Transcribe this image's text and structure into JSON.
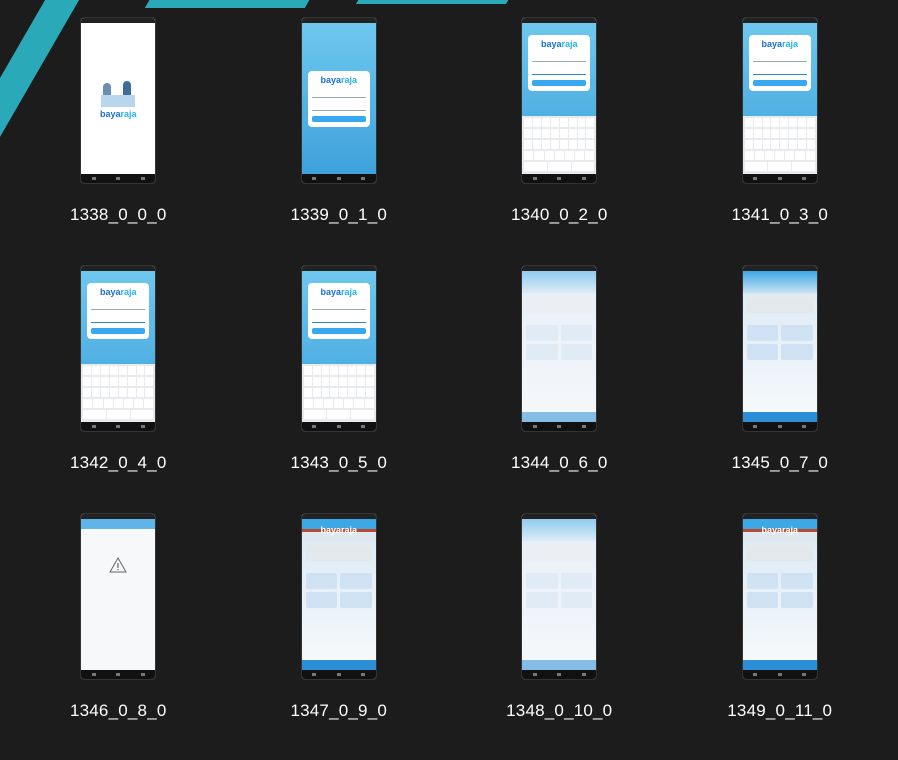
{
  "brand": {
    "logo_main": "baya",
    "logo_accent": "raja"
  },
  "tiles": [
    {
      "caption": "1338_0_0_0",
      "screen": "splash"
    },
    {
      "caption": "1339_0_1_0",
      "screen": "login"
    },
    {
      "caption": "1340_0_2_0",
      "screen": "login-keyboard"
    },
    {
      "caption": "1341_0_3_0",
      "screen": "login-keyboard"
    },
    {
      "caption": "1342_0_4_0",
      "screen": "login-keyboard"
    },
    {
      "caption": "1343_0_5_0",
      "screen": "login-keyboard"
    },
    {
      "caption": "1344_0_6_0",
      "screen": "home-faded"
    },
    {
      "caption": "1345_0_7_0",
      "screen": "home"
    },
    {
      "caption": "1346_0_8_0",
      "screen": "empty-state"
    },
    {
      "caption": "1347_0_9_0",
      "screen": "home-header"
    },
    {
      "caption": "1348_0_10_0",
      "screen": "home-faded"
    },
    {
      "caption": "1349_0_11_0",
      "screen": "home-header"
    }
  ],
  "colors": {
    "background": "#1c1c1c",
    "accent": "#2aa9b8",
    "app_blue": "#38a8ef"
  }
}
